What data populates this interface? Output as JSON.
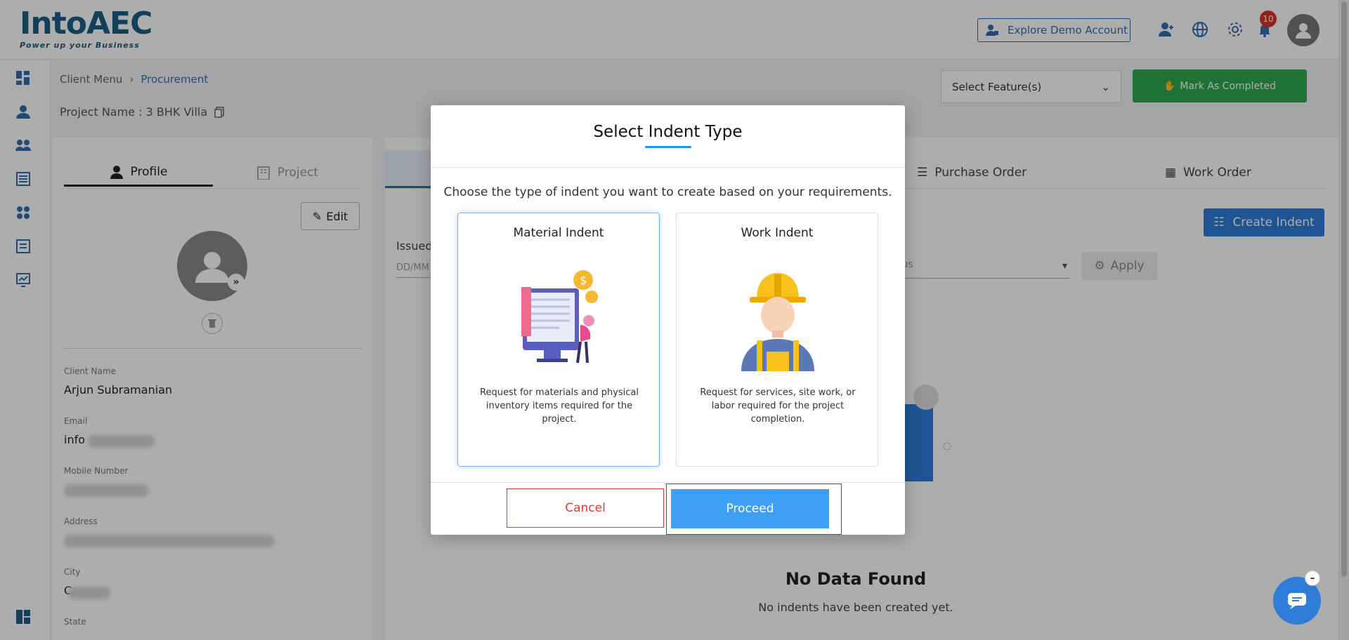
{
  "header": {
    "logo_main": "IntoAEC",
    "logo_tagline": "Power up your Business",
    "demo_button": "Explore Demo Account",
    "notification_count": "10"
  },
  "breadcrumb": {
    "parent": "Client Menu",
    "current": "Procurement"
  },
  "project": {
    "label": "Project Name : 3 BHK Villa"
  },
  "toolbar": {
    "feature_select": "Select Feature(s)",
    "mark_completed": "Mark As Completed"
  },
  "profile": {
    "tabs": [
      "Profile",
      "Project"
    ],
    "edit_button": "Edit",
    "fields": {
      "client_name_label": "Client Name",
      "client_name_value": "Arjun Subramanian",
      "email_label": "Email",
      "email_value": "info",
      "mobile_label": "Mobile Number",
      "address_label": "Address",
      "city_label": "City",
      "city_value": "C",
      "state_label": "State"
    }
  },
  "content": {
    "tabs": [
      "Purchase Order",
      "Work Order"
    ],
    "create_button": "Create Indent",
    "issued_label": "Issued",
    "date_placeholder": "DD/MM",
    "status_placeholder": "tus",
    "apply_button": "Apply",
    "empty_title": "No Data Found",
    "empty_subtitle": "No indents have been created yet."
  },
  "modal": {
    "title": "Select Indent Type",
    "description": "Choose the type of indent you want to create based on your requirements.",
    "options": [
      {
        "title": "Material Indent",
        "description": "Request for materials and physical inventory items required for the project."
      },
      {
        "title": "Work Indent",
        "description": "Request for services, site work, or labor required for the project completion."
      }
    ],
    "cancel": "Cancel",
    "proceed": "Proceed"
  },
  "colors": {
    "primary": "#2f7dd8",
    "success": "#2fa84f",
    "danger": "#e53935",
    "brand": "#1b5e86"
  }
}
